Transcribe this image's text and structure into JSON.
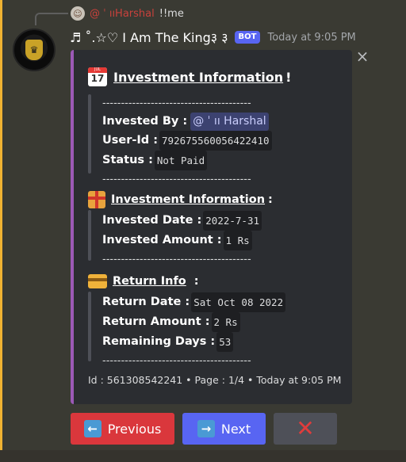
{
  "reply": {
    "avatar_glyph": "☺",
    "name": "@ ˈ ııHarshal",
    "text": "!!me"
  },
  "message": {
    "username": "♬ ˚.☆♡ I Am The King३ ३",
    "bot_tag": "BOT",
    "timestamp": "Today at 9:05 PM"
  },
  "embed": {
    "accent_color": "#9b59b6",
    "title": "Investment Information",
    "title_suffix": "!",
    "calendar_icon": {
      "month": "JUL",
      "day": "17"
    },
    "dashes": "----------------------------------------",
    "section1": {
      "invested_by_label": "Invested By :",
      "invested_by_value": "@ ˈ ıı Harshal",
      "user_id_label": "User-Id :",
      "user_id_value": "792675560056422410",
      "status_label": "Status :",
      "status_value": "Not Paid"
    },
    "section2": {
      "title": "Investment Information",
      "colon": ":",
      "invested_date_label": "Invested Date :",
      "invested_date_value": "2022-7-31",
      "invested_amount_label": "Invested Amount :",
      "invested_amount_value": "1 Rs"
    },
    "section3": {
      "title": "Return Info",
      "colon": ":",
      "return_date_label": "Return Date :",
      "return_date_value": "Sat Oct 08 2022",
      "return_amount_label": "Return Amount :",
      "return_amount_value": "2 Rs",
      "remaining_days_label": "Remaining Days :",
      "remaining_days_value": "53"
    },
    "footer": "Id : 561308542241 • Page : 1/4 • Today at 9:05 PM"
  },
  "buttons": {
    "previous_label": "Previous",
    "next_label": "Next",
    "close_label": "✕"
  },
  "colors": {
    "previous": "#da373c",
    "next": "#5865f2",
    "close": "#4e5058",
    "mention_bg": "#3c4270"
  }
}
